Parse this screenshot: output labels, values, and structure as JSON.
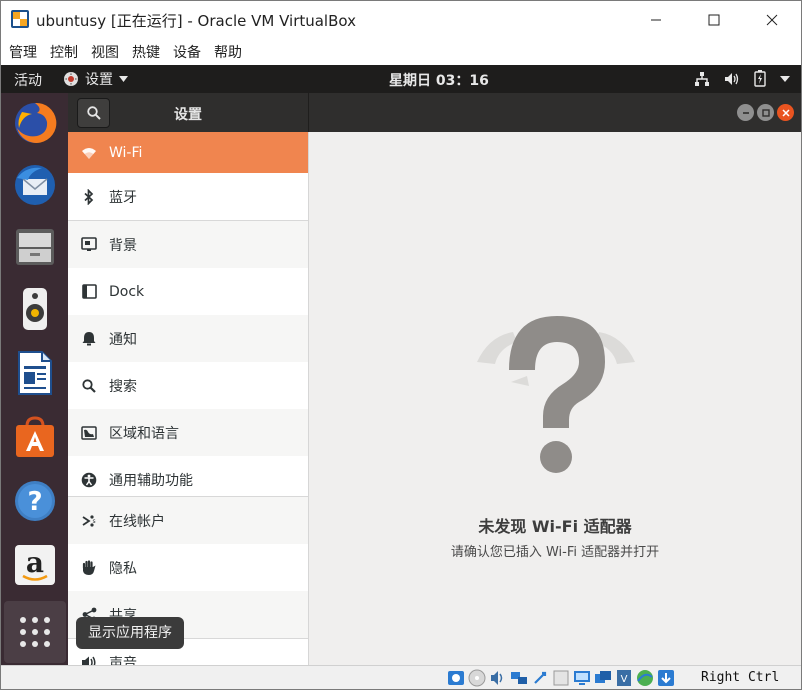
{
  "window": {
    "title": "ubuntusy [正在运行] - Oracle VM VirtualBox",
    "controls": [
      "minimize",
      "maximize",
      "close"
    ]
  },
  "host_menu": [
    "管理",
    "控制",
    "视图",
    "热键",
    "设备",
    "帮助"
  ],
  "gnome_bar": {
    "activities": "活动",
    "app_menu": "设置",
    "clock": "星期日 03：16",
    "tray_icons": [
      "network-wired-icon",
      "volume-icon",
      "battery-icon",
      "dropdown-arrow-icon"
    ]
  },
  "dock": {
    "apps": [
      "firefox-icon",
      "thunderbird-icon",
      "files-icon",
      "rhythmbox-icon",
      "libreoffice-writer-icon",
      "ubuntu-software-icon",
      "help-icon",
      "amazon-icon"
    ],
    "show_apps_icon": "app-grid-icon",
    "tooltip": "显示应用程序"
  },
  "settings": {
    "panel_title": "设置",
    "sidebar": [
      {
        "label": "Wi-Fi",
        "icon": "wifi-icon",
        "selected": true
      },
      {
        "label": "蓝牙",
        "icon": "bluetooth-icon"
      },
      {
        "label": "背景",
        "icon": "background-icon"
      },
      {
        "label": "Dock",
        "icon": "dock-icon"
      },
      {
        "label": "通知",
        "icon": "bell-icon"
      },
      {
        "label": "搜索",
        "icon": "search-icon"
      },
      {
        "label": "区域和语言",
        "icon": "region-icon"
      },
      {
        "label": "通用辅助功能",
        "icon": "accessibility-icon"
      },
      {
        "label": "在线帐户",
        "icon": "online-accounts-icon"
      },
      {
        "label": "隐私",
        "icon": "hand-icon"
      },
      {
        "label": "共享",
        "icon": "share-icon"
      },
      {
        "label": "声音",
        "icon": "speaker-icon"
      }
    ],
    "content": {
      "headline": "未发现 Wi-Fi 适配器",
      "subline": "请确认您已插入 Wi-Fi 适配器并打开"
    }
  },
  "vbox_status": {
    "host_key": "Right Ctrl"
  },
  "colors": {
    "accent": "#f0854f",
    "gnome_bar": "#1e1d1c",
    "dock": "#3a2b33",
    "header": "#2f2e2d"
  }
}
